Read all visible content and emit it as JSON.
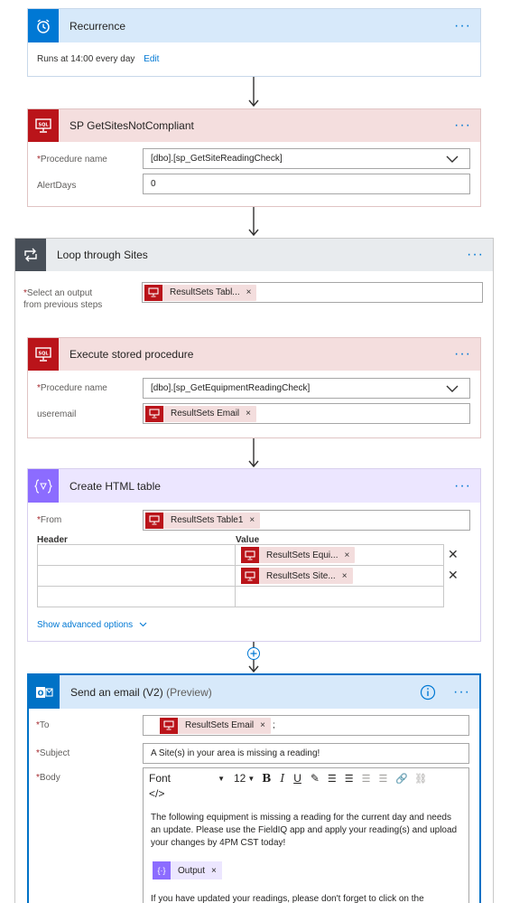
{
  "recurrence": {
    "title": "Recurrence",
    "summary": "Runs at 14:00 every day",
    "edit_link": "Edit",
    "accent": "#0078d4"
  },
  "sp_get_sites": {
    "title": "SP GetSitesNotCompliant",
    "fields": [
      {
        "label": "Procedure name",
        "required": true,
        "value": "[dbo].[sp_GetSiteReadingCheck]"
      },
      {
        "label": "AlertDays",
        "required": false,
        "value": "0"
      }
    ],
    "accent": "#ba141a"
  },
  "loop": {
    "title": "Loop through Sites",
    "select_label_line1": "Select an output",
    "select_label_line2": "from previous steps",
    "select_token": "ResultSets Tabl...",
    "accent": "#484f58"
  },
  "execute_sp": {
    "title": "Execute stored procedure",
    "procedure_label": "Procedure name",
    "procedure_value": "[dbo].[sp_GetEquipmentReadingCheck]",
    "useremail_label": "useremail",
    "useremail_token": "ResultSets Email"
  },
  "html_table": {
    "title": "Create HTML table",
    "from_label": "From",
    "from_token": "ResultSets Table1",
    "header_col": "Header",
    "value_col": "Value",
    "rows": [
      {
        "header": "",
        "value_token": "ResultSets Equi..."
      },
      {
        "header": "",
        "value_token": "ResultSets Site..."
      },
      {
        "header": "",
        "value_token": ""
      }
    ],
    "advanced_link": "Show advanced options",
    "accent": "#8c6cff"
  },
  "send_email": {
    "title": "Send an email (V2)",
    "preview": "(Preview)",
    "to_label": "To",
    "to_token": "ResultSets Email",
    "to_suffix": ";",
    "subject_label": "Subject",
    "subject_value": "A Site(s) in your area is missing a reading!",
    "body_label": "Body",
    "font_name": "Font",
    "font_size": "12",
    "body_paragraph": "The following equipment is missing a reading for the current day and needs an update. Please use the FieldIQ app and apply your reading(s) and upload your changes by 4PM CST today!",
    "output_token": "Output",
    "body_trailing": "If you have updated your readings, please don't forget to click on the",
    "accent": "#0072c6"
  },
  "icons": {
    "recurrence": "alarm-clock-icon",
    "sql": "sql-monitor-icon",
    "loop": "loop-arrows-icon",
    "data_operation": "curly-braces-icon",
    "outlook": "outlook-icon",
    "info": "info-icon",
    "add_step": "plus-circle-icon"
  }
}
